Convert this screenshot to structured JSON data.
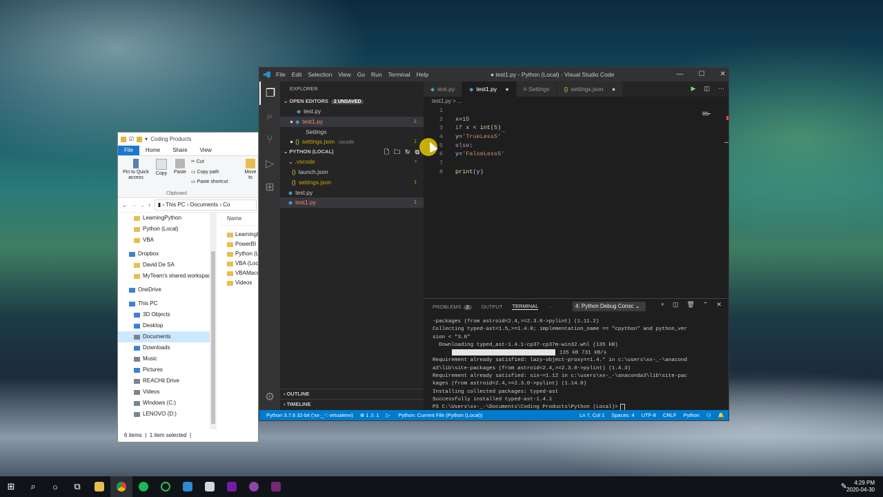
{
  "file_explorer": {
    "title": "Coding Products",
    "ribbon_tabs": [
      "File",
      "Home",
      "Share",
      "View"
    ],
    "ribbon": {
      "pin_label": "Pin to Quick access",
      "copy_label": "Copy",
      "paste_label": "Paste",
      "cut_label": "Cut",
      "copy_path_label": "Copy path",
      "paste_shortcut_label": "Paste shortcut",
      "move_label": "Move to",
      "group_label": "Clipboard"
    },
    "address": [
      "This PC",
      "Documents",
      "Co"
    ],
    "nav_items": [
      {
        "label": "LearningPython",
        "kind": "folder"
      },
      {
        "label": "Python (Local)",
        "kind": "folder"
      },
      {
        "label": "VBA",
        "kind": "folder"
      },
      {
        "label": "Dropbox",
        "kind": "blue"
      },
      {
        "label": "David De SA",
        "kind": "folder"
      },
      {
        "label": "MyTeam's shared workspace",
        "kind": "folder"
      },
      {
        "label": "OneDrive",
        "kind": "blue"
      },
      {
        "label": "This PC",
        "kind": "blue"
      },
      {
        "label": "3D Objects",
        "kind": "blue"
      },
      {
        "label": "Desktop",
        "kind": "blue"
      },
      {
        "label": "Documents",
        "kind": "gray"
      },
      {
        "label": "Downloads",
        "kind": "blue"
      },
      {
        "label": "Music",
        "kind": "gray"
      },
      {
        "label": "Pictures",
        "kind": "blue"
      },
      {
        "label": "REACHit Drive",
        "kind": "gray"
      },
      {
        "label": "Videos",
        "kind": "gray"
      },
      {
        "label": "Windows (C:)",
        "kind": "gray"
      },
      {
        "label": "LENOVO (D:)",
        "kind": "gray"
      }
    ],
    "column_header": "Name",
    "files": [
      "LearningI",
      "PowerBI",
      "Python (L",
      "VBA (Loc",
      "VBAMacr",
      "Videos"
    ],
    "status_items": "6 items",
    "status_selected": "1 item selected"
  },
  "vscode": {
    "menu": [
      "File",
      "Edit",
      "Selection",
      "View",
      "Go",
      "Run",
      "Terminal",
      "Help"
    ],
    "window_title": "● test1.py - Python (Local) - Visual Studio Code",
    "explorer_label": "EXPLORER",
    "open_editors_label": "OPEN EDITORS",
    "unsaved_badge": "2 UNSAVED",
    "open_editors": [
      {
        "label": "test.py",
        "style": "py",
        "dot": false,
        "count": ""
      },
      {
        "label": "test1.py",
        "style": "py-red",
        "dot": true,
        "count": "1"
      },
      {
        "label": "Settings",
        "style": "italic",
        "dot": false,
        "count": ""
      },
      {
        "label": "settings.json",
        "style": "json-yel",
        "dot": true,
        "count": "1",
        "suffix": ".vscode"
      }
    ],
    "workspace_label": "PYTHON (LOCAL)",
    "tree": [
      {
        "label": ".vscode",
        "indent": 1,
        "kind": "folder",
        "count": "•"
      },
      {
        "label": "launch.json",
        "indent": 2,
        "kind": "json",
        "count": ""
      },
      {
        "label": "settings.json",
        "indent": 2,
        "kind": "json-yel",
        "count": "1"
      },
      {
        "label": "test.py",
        "indent": 1,
        "kind": "py",
        "count": ""
      },
      {
        "label": "test1.py",
        "indent": 1,
        "kind": "py-red",
        "count": "1"
      }
    ],
    "outline_label": "OUTLINE",
    "timeline_label": "TIMELINE",
    "tabs": [
      {
        "label": "test.py",
        "active": false,
        "dot": false
      },
      {
        "label": "test1.py",
        "active": true,
        "dot": true
      },
      {
        "label": "Settings",
        "active": false,
        "dot": false
      },
      {
        "label": "settings.json",
        "active": false,
        "dot": true
      }
    ],
    "breadcrumb": "test1.py > ...",
    "code_lines": [
      {
        "n": "1",
        "code": ""
      },
      {
        "n": "2",
        "code": "x=15"
      },
      {
        "n": "3",
        "code": "if x < int(5)"
      },
      {
        "n": "4",
        "code": "y='TrueLess5'"
      },
      {
        "n": "5",
        "code": "else:"
      },
      {
        "n": "6",
        "code": "y='FalseLess5'"
      },
      {
        "n": "7",
        "code": ""
      },
      {
        "n": "8",
        "code": "print(y)"
      }
    ],
    "panel_tabs": {
      "problems": "PROBLEMS",
      "problems_count": "2",
      "output": "OUTPUT",
      "terminal": "TERMINAL",
      "more": "···"
    },
    "terminal_select": "4: Python Debug Consc",
    "terminal_lines": [
      "-packages (from astroid<2.4,>=2.3.0->pylint) (1.11.2)",
      "Collecting typed-ast<1.5,>=1.4.0; implementation_name == \"cpython\" and python_ver",
      "sion < \"3.8\"",
      "  Downloading typed_ast-1.4.1-cp37-cp37m-win32.whl (135 kB)",
      "",
      "Requirement already satisfied: lazy-object-proxy==1.4.* in c:\\users\\xx-_-\\anacond",
      "a3\\lib\\site-packages (from astroid<2.4,>=2.3.0->pylint) (1.4.3)",
      "Requirement already satisfied: six~=1.12 in c:\\users\\xx-_-\\anaconda3\\lib\\site-pac",
      "kages (from astroid<2.4,>=2.3.0->pylint) (1.14.0)",
      "Installing collected packages: typed-ast",
      "Successfully installed typed-ast-1.4.1",
      "PS C:\\Users\\xx-_-\\Documents\\Coding Products\\Python (Local)> "
    ],
    "download_progress_text": "135 kB 731 kB/s",
    "download_progress": 1.0,
    "status": {
      "interpreter": "Python 3.7.6 32-bit ('xx-_-': virtualenv)",
      "problems": "⊗ 1 ⚠ 1",
      "run_config": "Python: Current File (Python (Local))",
      "position": "Ln 7, Col 1",
      "spaces": "Spaces: 4",
      "encoding": "UTF-8",
      "eol": "CRLF",
      "language": "Python"
    }
  },
  "taskbar": {
    "time": "4:29 PM",
    "date": "2020-04-30"
  },
  "colors": {
    "vscode_statusbar": "#007acc",
    "explorer_file_tab": "#1979ca",
    "error_red": "#f48771",
    "warning_yellow": "#cca700"
  }
}
